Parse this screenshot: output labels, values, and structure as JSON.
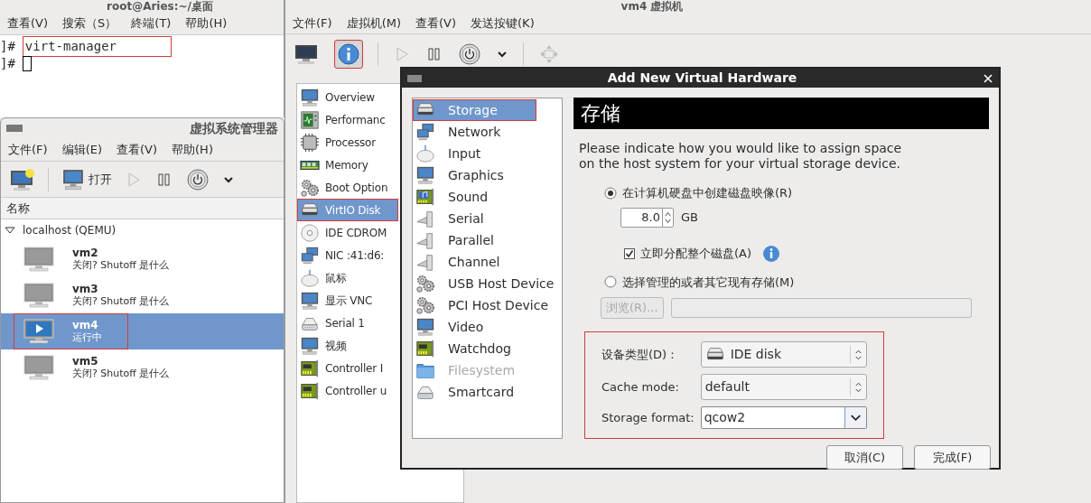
{
  "terminal": {
    "title": "root@Aries:~/桌面",
    "menu": [
      "查看(V)",
      "搜索（S）",
      "終端(T)",
      "帮助(H)"
    ],
    "lines": [
      {
        "prompt": "]#",
        "text": "virt-manager",
        "annotated": true,
        "cursor": false
      },
      {
        "prompt": "]#",
        "annotated": false,
        "cursor": true
      }
    ]
  },
  "manager": {
    "title": "虚拟系统管理器",
    "menu": [
      "文件(F)",
      "编辑(E)",
      "查看(V)",
      "帮助(H)"
    ],
    "toolbar": [
      {
        "kind": "new"
      },
      {
        "kind": "separator"
      },
      {
        "kind": "open",
        "label": "打开"
      },
      {
        "kind": "play",
        "disabled": true
      },
      {
        "kind": "pause"
      },
      {
        "kind": "power"
      },
      {
        "kind": "caret"
      }
    ],
    "column": "名称",
    "tree": {
      "label": "localhost (QEMU)",
      "expanded": true,
      "children": [
        {
          "name": "vm2",
          "status": "关闭? Shutoff 是什么",
          "running": false,
          "selected": false,
          "annotated": false
        },
        {
          "name": "vm3",
          "status": "关闭? Shutoff 是什么",
          "running": false,
          "selected": false,
          "annotated": false
        },
        {
          "name": "vm4",
          "status": "运行中",
          "running": true,
          "selected": true,
          "annotated": true
        },
        {
          "name": "vm5",
          "status": "关闭? Shutoff 是什么",
          "running": false,
          "selected": false,
          "annotated": false
        }
      ]
    }
  },
  "vm_window": {
    "title": "vm4 虚拟机",
    "menu": [
      "文件(F)",
      "虚拟机(M)",
      "查看(V)",
      "发送按键(K)"
    ],
    "toolbar": [
      {
        "kind": "console",
        "selected": false
      },
      {
        "kind": "details",
        "selected": true,
        "annotated": true
      },
      {
        "kind": "separator"
      },
      {
        "kind": "play",
        "disabled": true
      },
      {
        "kind": "pause"
      },
      {
        "kind": "power"
      },
      {
        "kind": "caret"
      },
      {
        "kind": "separator"
      },
      {
        "kind": "move",
        "disabled": true
      }
    ],
    "devices": [
      {
        "label": "Overview",
        "kind": "monitor",
        "selected": false,
        "annotated": false
      },
      {
        "label": "Performanc",
        "kind": "chart",
        "selected": false,
        "annotated": false
      },
      {
        "label": "Processor",
        "kind": "chip",
        "selected": false,
        "annotated": false
      },
      {
        "label": "Memory",
        "kind": "ram",
        "selected": false,
        "annotated": false
      },
      {
        "label": "Boot Option",
        "kind": "gears",
        "selected": false,
        "annotated": false
      },
      {
        "label": "VirtIO Disk",
        "kind": "disk",
        "selected": true,
        "annotated": true
      },
      {
        "label": "IDE CDROM",
        "kind": "cdrom",
        "selected": false,
        "annotated": false
      },
      {
        "label": "NIC :41:d6:",
        "kind": "nic",
        "selected": false,
        "annotated": false
      },
      {
        "label": "鼠标",
        "kind": "mouse",
        "selected": false,
        "annotated": false
      },
      {
        "label": "显示 VNC",
        "kind": "monitor",
        "selected": false,
        "annotated": false
      },
      {
        "label": "Serial 1",
        "kind": "serial",
        "selected": false,
        "annotated": false
      },
      {
        "label": "视频",
        "kind": "monitor",
        "selected": false,
        "annotated": false
      },
      {
        "label": "Controller I",
        "kind": "card",
        "selected": false,
        "annotated": false
      },
      {
        "label": "Controller u",
        "kind": "card",
        "selected": false,
        "annotated": false
      }
    ]
  },
  "dialog": {
    "title": "Add New Virtual Hardware",
    "hardware": [
      {
        "label": "Storage",
        "kind": "disk",
        "selected": true,
        "disabled": false,
        "annotated": true
      },
      {
        "label": "Network",
        "kind": "nic",
        "selected": false,
        "disabled": false,
        "annotated": false
      },
      {
        "label": "Input",
        "kind": "mouse",
        "selected": false,
        "disabled": false,
        "annotated": false
      },
      {
        "label": "Graphics",
        "kind": "monitor",
        "selected": false,
        "disabled": false,
        "annotated": false
      },
      {
        "label": "Sound",
        "kind": "sound",
        "selected": false,
        "disabled": false,
        "annotated": false
      },
      {
        "label": "Serial",
        "kind": "plug",
        "selected": false,
        "disabled": false,
        "annotated": false
      },
      {
        "label": "Parallel",
        "kind": "plug",
        "selected": false,
        "disabled": false,
        "annotated": false
      },
      {
        "label": "Channel",
        "kind": "plug",
        "selected": false,
        "disabled": false,
        "annotated": false
      },
      {
        "label": "USB Host Device",
        "kind": "gears",
        "selected": false,
        "disabled": false,
        "annotated": false
      },
      {
        "label": "PCI Host Device",
        "kind": "gears",
        "selected": false,
        "disabled": false,
        "annotated": false
      },
      {
        "label": "Video",
        "kind": "monitor",
        "selected": false,
        "disabled": false,
        "annotated": false
      },
      {
        "label": "Watchdog",
        "kind": "card",
        "selected": false,
        "disabled": false,
        "annotated": false
      },
      {
        "label": "Filesystem",
        "kind": "folder",
        "selected": false,
        "disabled": true,
        "annotated": false
      },
      {
        "label": "Smartcard",
        "kind": "serial",
        "selected": false,
        "disabled": false,
        "annotated": false
      }
    ],
    "heading": "存储",
    "description": [
      "Please indicate how you would like to assign space",
      "on the host system for your virtual storage device."
    ],
    "create_option": {
      "label": "在计算机硬盘中创建磁盘映像(R)",
      "selected": true
    },
    "size": {
      "value": "8.0",
      "unit": "GB"
    },
    "allocate": {
      "label": "立即分配整个磁盘(A)",
      "checked": true
    },
    "existing_option": {
      "label": "选择管理的或者其它现有存储(M)",
      "selected": false
    },
    "browse_button": {
      "label": "浏览(R)...",
      "disabled": true
    },
    "settings": {
      "annotated": true,
      "fields": [
        {
          "kind": "disk_combo",
          "label": "设备类型(D)：",
          "value": "IDE disk"
        },
        {
          "kind": "combo",
          "label": "Cache mode:",
          "value": "default"
        },
        {
          "kind": "entry",
          "label": "Storage format:",
          "value": "qcow2"
        }
      ]
    },
    "buttons": [
      "取消(C)",
      "完成(F)"
    ]
  }
}
